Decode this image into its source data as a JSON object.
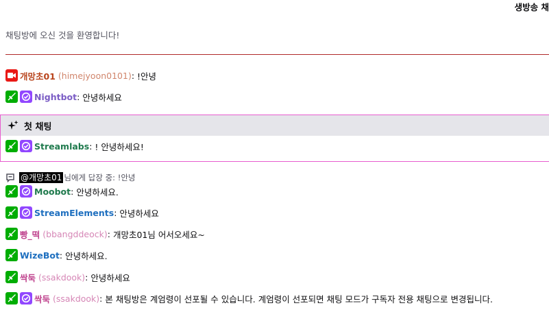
{
  "header": {
    "title": "생방송 채"
  },
  "welcome": "채팅방에 오신 것을 환영합니다!",
  "colors": {
    "divider": "#b02828",
    "moderator_badge": "#00ad03",
    "verified_badge": "#9147ff",
    "broadcaster_badge": "#e91916",
    "first_chat_border": "#e85ccf",
    "first_chat_bg": "#e5e5ea"
  },
  "messages": [
    {
      "badges": [
        "broadcaster-icon"
      ],
      "user": "개망초01",
      "login": "(himejyoon0101)",
      "sep": ":",
      "text": "!안녕",
      "user_color": "#b8431b"
    },
    {
      "badges": [
        "sword-icon",
        "verified-check-icon"
      ],
      "user": "Nightbot",
      "login": "",
      "sep": ":",
      "text": "안녕하세요",
      "user_color": "#7b5dc5"
    },
    {
      "badges": [
        "sword-icon",
        "verified-check-icon"
      ],
      "user": "Streamlabs",
      "login": "",
      "sep": ":",
      "text": "! 안녕하세요!",
      "user_color": "#1f7a4d"
    },
    {
      "badges": [
        "sword-icon",
        "verified-check-icon"
      ],
      "user": "Moobot",
      "login": "",
      "sep": ":",
      "text": "안녕하세요.",
      "user_color": "#1f7a4d"
    },
    {
      "badges": [
        "sword-icon",
        "verified-check-icon"
      ],
      "user": "StreamElements",
      "login": "",
      "sep": ":",
      "text": "안녕하세요",
      "user_color": "#1e6fbf"
    },
    {
      "badges": [
        "sword-icon"
      ],
      "user": "빵_떡",
      "login": "(bbangddeock)",
      "sep": ":",
      "text": "개망초01님 어서오세요~",
      "user_color": "#c0458f"
    },
    {
      "badges": [
        "sword-icon"
      ],
      "user": "WizeBot",
      "login": "",
      "sep": ":",
      "text": "안녕하세요.",
      "user_color": "#1e6fbf"
    },
    {
      "badges": [
        "sword-icon"
      ],
      "user": "싹둑",
      "login": "(ssakdook)",
      "sep": ":",
      "text": "안녕하세요",
      "user_color": "#c0458f"
    },
    {
      "badges": [
        "sword-icon",
        "verified-check-icon"
      ],
      "user": "싹둑",
      "login": "(ssakdook)",
      "sep": ":",
      "text": "본 채팅방은 계엄령이 선포될 수 있습니다. 계엄령이 선포되면 채팅 모드가 구독자 전용 채팅으로 변경됩니다.",
      "user_color": "#c0458f"
    }
  ],
  "first_chat": {
    "label": "첫 채팅",
    "icon": "sparkle-icon"
  },
  "reply": {
    "mention": "@개망초01",
    "suffix": "님에게 답장 중: !안녕",
    "icon": "reply-bubble-icon"
  }
}
